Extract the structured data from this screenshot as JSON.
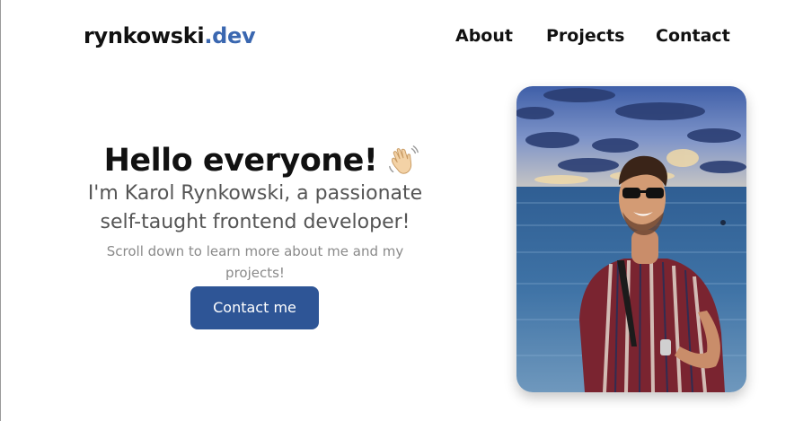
{
  "header": {
    "logo_main": "rynkowski",
    "logo_accent": ".dev",
    "nav": {
      "about": "About",
      "projects": "Projects",
      "contact": "Contact"
    }
  },
  "hero": {
    "title": "Hello everyone!",
    "wave_icon": "waving-hand-icon",
    "subtitle_line1": "I'm Karol Rynkowski, a passionate",
    "subtitle_line2": "self-taught frontend developer!",
    "note": "Scroll down to learn more about me and my projects!",
    "cta_label": "Contact me"
  },
  "photo": {
    "subject": "profile-photo"
  },
  "colors": {
    "accent": "#3a67b0",
    "button": "#2e5596",
    "text": "#111111",
    "muted": "#8a8a8a"
  }
}
